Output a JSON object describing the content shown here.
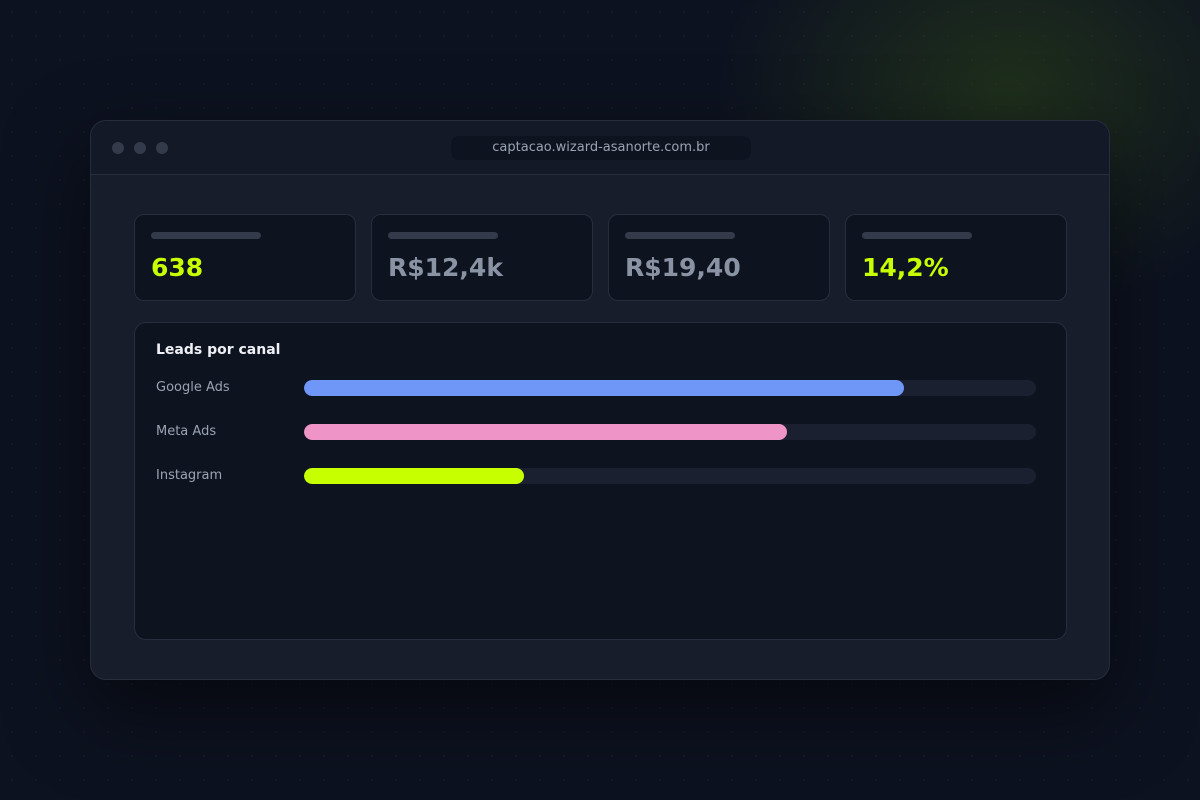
{
  "browser": {
    "url": "captacao.wizard-asanorte.com.br"
  },
  "stats": [
    {
      "value": "638",
      "color": "#c8ff00"
    },
    {
      "value": "R$12,4k",
      "color": "#8a93a3"
    },
    {
      "value": "R$19,40",
      "color": "#8a93a3"
    },
    {
      "value": "14,2%",
      "color": "#c8ff00"
    }
  ],
  "chart": {
    "title": "Leads por canal"
  },
  "chart_data": {
    "type": "bar",
    "orientation": "horizontal",
    "title": "Leads por canal",
    "categories": [
      "Google Ads",
      "Meta Ads",
      "Instagram"
    ],
    "values": [
      82,
      66,
      30
    ],
    "xlim": [
      0,
      100
    ],
    "colors": [
      "#6e97f8",
      "#ee94c6",
      "#c8ff00"
    ],
    "grid": false,
    "legend": "none"
  }
}
